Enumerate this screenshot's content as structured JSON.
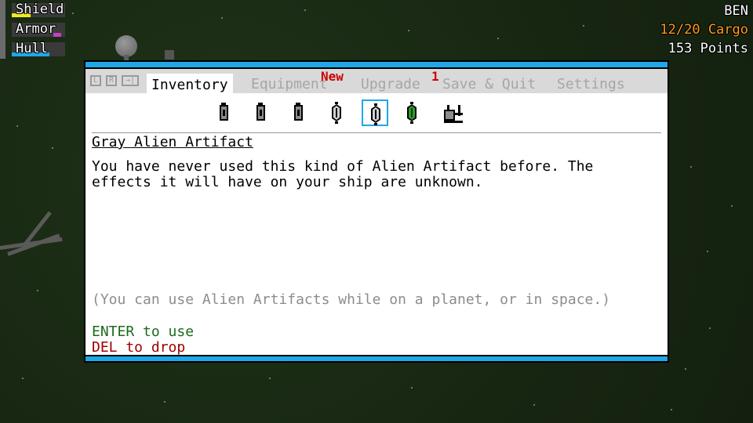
{
  "hud": {
    "bars": [
      {
        "label": "Shield",
        "color": "#f2e81f"
      },
      {
        "label": "Armor",
        "color": "#c040c0"
      },
      {
        "label": "Hull",
        "color": "#1fa8e8"
      }
    ],
    "player_name": "BEN",
    "cargo": "12/20 Cargo",
    "points": "153 Points"
  },
  "dialog": {
    "tab_icons": [
      "L",
      "R",
      "→|"
    ],
    "tabs": [
      {
        "label": "Inventory",
        "active": true
      },
      {
        "label": "Equipment",
        "active": false
      },
      {
        "label": "Upgrade",
        "active": false
      },
      {
        "label": "Save & Quit",
        "active": false
      },
      {
        "label": "Settings",
        "active": false
      }
    ],
    "badges": {
      "equipment": "New",
      "upgrade": "1"
    },
    "inventory_items": [
      {
        "icon": "battery-cell-icon"
      },
      {
        "icon": "battery-cell-icon"
      },
      {
        "icon": "battery-cell-icon"
      },
      {
        "icon": "alien-artifact-icon"
      },
      {
        "icon": "alien-artifact-icon",
        "selected": true
      },
      {
        "icon": "green-artifact-icon"
      },
      {
        "icon": "machine-part-icon"
      }
    ],
    "item_title": "Gray Alien Artifact",
    "item_description": "You have never used this kind of Alien Artifact before. The effects it will have on your ship are unknown.",
    "hint": "(You can use Alien Artifacts while on a planet, or in space.)",
    "enter_action": "ENTER to use",
    "del_action": "DEL to drop"
  },
  "colors": {
    "accent": "#1fa8e8",
    "cargo": "#ff9b1a",
    "enter": "#1a6b1a",
    "del": "#a00000",
    "badge": "#cc0000"
  }
}
